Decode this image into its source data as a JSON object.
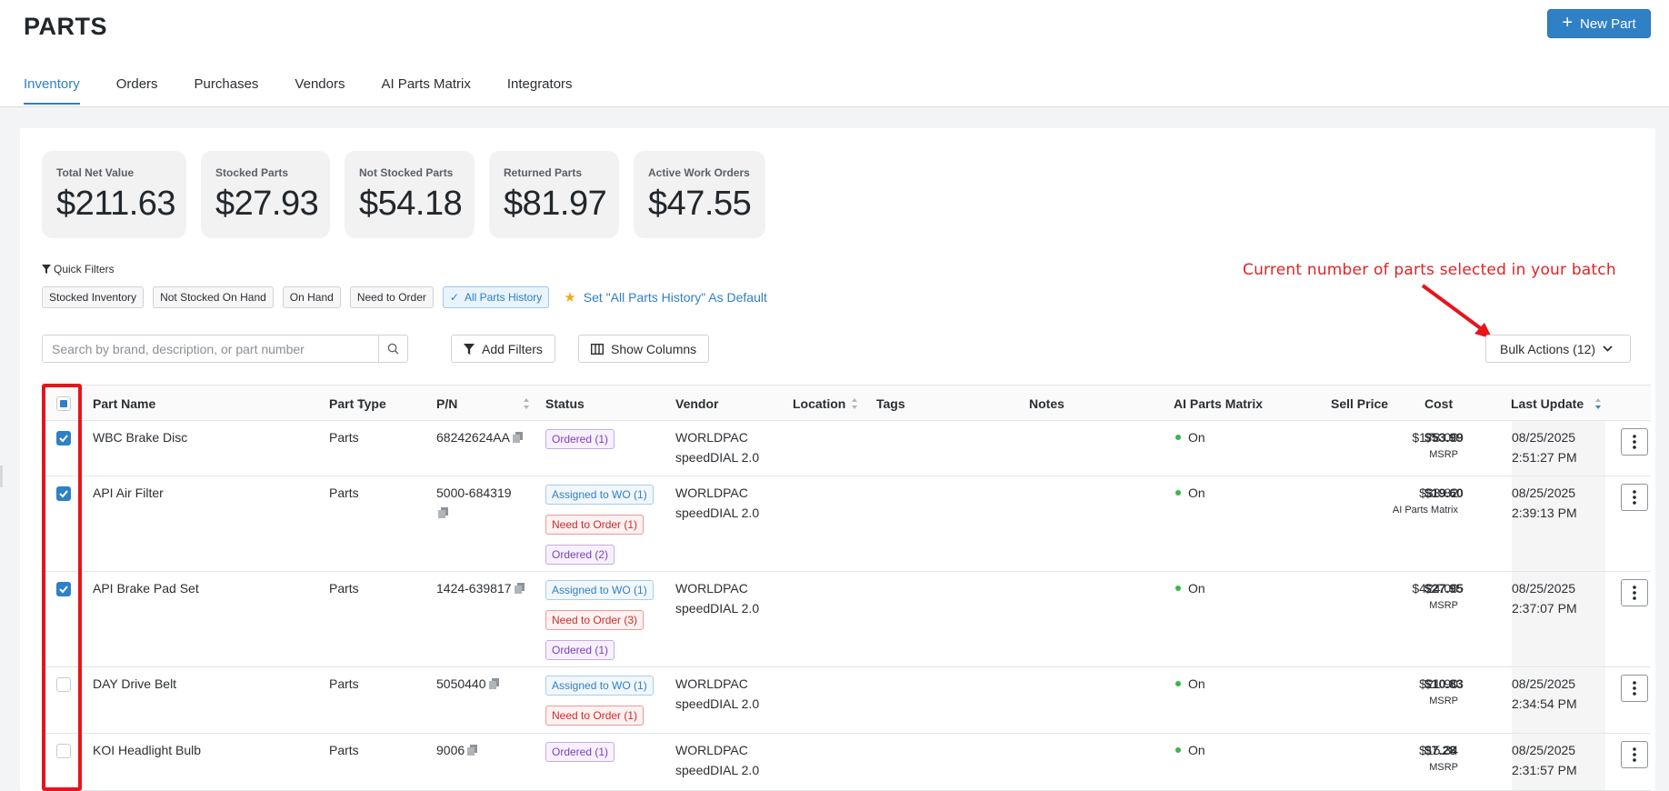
{
  "page": {
    "title": "PARTS",
    "new_part_label": "New Part"
  },
  "tabs": [
    "Inventory",
    "Orders",
    "Purchases",
    "Vendors",
    "AI Parts Matrix",
    "Integrators"
  ],
  "stats": [
    {
      "label": "Total Net Value",
      "value": "$211.63"
    },
    {
      "label": "Stocked Parts",
      "value": "$27.93"
    },
    {
      "label": "Not Stocked Parts",
      "value": "$54.18"
    },
    {
      "label": "Returned Parts",
      "value": "$81.97"
    },
    {
      "label": "Active Work Orders",
      "value": "$47.55"
    }
  ],
  "quick_filters": {
    "label": "Quick Filters",
    "chips": [
      "Stocked Inventory",
      "Not Stocked On Hand",
      "On Hand",
      "Need to Order",
      "All Parts History"
    ],
    "active_chip": "All Parts History",
    "set_default": "Set \"All Parts History\" As Default"
  },
  "annotation": "Current number of parts selected in your batch",
  "toolbar": {
    "search_placeholder": "Search by brand, description, or part number",
    "add_filters": "Add Filters",
    "show_columns": "Show Columns",
    "bulk_actions": "Bulk Actions (12)"
  },
  "table": {
    "headers": {
      "part_name": "Part Name",
      "part_type": "Part Type",
      "pn": "P/N",
      "status": "Status",
      "vendor": "Vendor",
      "location": "Location",
      "tags": "Tags",
      "notes": "Notes",
      "ai_matrix": "AI Parts Matrix",
      "sell_price": "Sell Price",
      "cost": "Cost",
      "last_update": "Last Update"
    },
    "rows": [
      {
        "checked": true,
        "name": "WBC Brake Disc",
        "type": "Parts",
        "pn": "68242624AA",
        "statuses": [
          {
            "kind": "ordered",
            "text": "Ordered (1)"
          }
        ],
        "vendor_line1": "WORLDPAC",
        "vendor_line2": "speedDIAL 2.0",
        "ai": "On",
        "sell": "$178.00",
        "sell_sub": "MSRP",
        "cost": "$53.99",
        "date": "08/25/2025",
        "time": "2:51:27 PM"
      },
      {
        "checked": true,
        "name": "API Air Filter",
        "type": "Parts",
        "pn": "5000-684319",
        "statuses": [
          {
            "kind": "assigned",
            "text": "Assigned to WO (1)"
          },
          {
            "kind": "need",
            "text": "Need to Order (1)"
          },
          {
            "kind": "ordered",
            "text": "Ordered (2)"
          }
        ],
        "vendor_line1": "WORLDPAC",
        "vendor_line2": "speedDIAL 2.0",
        "ai": "On",
        "sell": "$33.82",
        "sell_sub": "AI Parts Matrix",
        "cost": "$19.60",
        "date": "08/25/2025",
        "time": "2:39:13 PM"
      },
      {
        "checked": true,
        "name": "API Brake Pad Set",
        "type": "Parts",
        "pn": "1424-639817",
        "statuses": [
          {
            "kind": "assigned",
            "text": "Assigned to WO (1)"
          },
          {
            "kind": "need",
            "text": "Need to Order (3)"
          },
          {
            "kind": "ordered",
            "text": "Ordered (1)"
          }
        ],
        "vendor_line1": "WORLDPAC",
        "vendor_line2": "speedDIAL 2.0",
        "ai": "On",
        "sell": "$424.00",
        "sell_sub": "MSRP",
        "cost": "$27.95",
        "date": "08/25/2025",
        "time": "2:37:07 PM"
      },
      {
        "checked": false,
        "name": "DAY Drive Belt",
        "type": "Parts",
        "pn": "5050440",
        "statuses": [
          {
            "kind": "assigned",
            "text": "Assigned to WO (1)"
          },
          {
            "kind": "need",
            "text": "Need to Order (1)"
          }
        ],
        "vendor_line1": "WORLDPAC",
        "vendor_line2": "speedDIAL 2.0",
        "ai": "On",
        "sell": "$21.90",
        "sell_sub": "MSRP",
        "cost": "$10.83",
        "date": "08/25/2025",
        "time": "2:34:54 PM"
      },
      {
        "checked": false,
        "name": "KOI Headlight Bulb",
        "type": "Parts",
        "pn": "9006",
        "statuses": [
          {
            "kind": "ordered",
            "text": "Ordered (1)"
          }
        ],
        "vendor_line1": "WORLDPAC",
        "vendor_line2": "speedDIAL 2.0",
        "ai": "On",
        "sell": "$15.34",
        "sell_sub": "MSRP",
        "cost": "$7.28",
        "date": "08/25/2025",
        "time": "2:31:57 PM"
      }
    ]
  },
  "colors": {
    "accent": "#2f80c4",
    "annotation_red": "#e02424",
    "ordered": "#7b3fbf",
    "need_to_order": "#d12b2b",
    "on_dot": "#3cb54a"
  }
}
